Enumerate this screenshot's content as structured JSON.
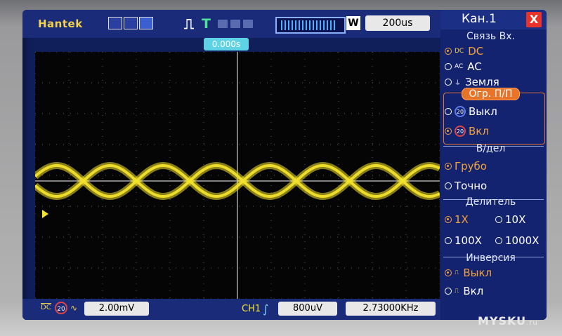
{
  "top": {
    "brand": "Hantek",
    "trigger_mode_letter": "T",
    "timebase_mode": "W",
    "timebase": "200us",
    "trigger_position": "0.000s"
  },
  "bottom": {
    "coupling": "DC",
    "bw_limit": "20",
    "ch_volts_div": "2.00mV",
    "trig_source": "CH1",
    "trig_level": "800uV",
    "frequency": "2.73000KHz"
  },
  "menu": {
    "title": "Кан.1",
    "close": "X",
    "coupling": {
      "header": "Связь Вх.",
      "options": [
        {
          "label": "DC",
          "icon": "DC",
          "selected": true
        },
        {
          "label": "AC",
          "icon": "AC",
          "selected": false
        },
        {
          "label": "Земля",
          "icon": "",
          "selected": false
        }
      ]
    },
    "bw_limit": {
      "header": "Огр. П/П",
      "options": [
        {
          "label": "Выкл",
          "icon": "20",
          "selected": false
        },
        {
          "label": "Вкл",
          "icon": "20",
          "selected": true
        }
      ]
    },
    "volts_div": {
      "header": "В/дел",
      "options": [
        {
          "label": "Грубо",
          "selected": true
        },
        {
          "label": "Точно",
          "selected": false
        }
      ]
    },
    "probe": {
      "header": "Делитель",
      "options": [
        {
          "label": "1X",
          "selected": true
        },
        {
          "label": "10X",
          "selected": false
        },
        {
          "label": "100X",
          "selected": false
        },
        {
          "label": "1000X",
          "selected": false
        }
      ]
    },
    "invert": {
      "header": "Инверсия",
      "options": [
        {
          "label": "Выкл",
          "selected": true
        },
        {
          "label": "Вкл",
          "selected": false
        }
      ]
    }
  },
  "watermark": "MYSKU",
  "watermark_suffix": ".ru",
  "colors": {
    "trace": "#f2e22a",
    "menu_accent": "#e8742a",
    "selected": "#f2a13a",
    "grid": "#9a9a9a"
  }
}
